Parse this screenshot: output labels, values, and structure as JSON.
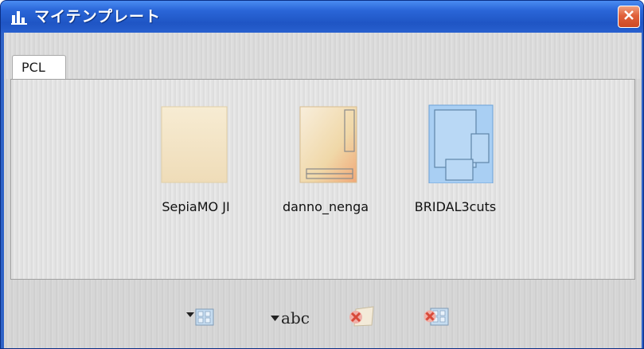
{
  "window": {
    "title": "マイテンプレート",
    "icon": "chart-bars-icon",
    "close_icon": "close-icon"
  },
  "tabs": [
    {
      "label": "PCL",
      "selected": true
    }
  ],
  "templates": [
    {
      "label": "SepiaMO JI",
      "thumbnail": "sepia-page-thumbnail"
    },
    {
      "label": "danno_nenga",
      "thumbnail": "nenga-layout-thumbnail"
    },
    {
      "label": "BRIDAL3cuts",
      "thumbnail": "bridal-layout-thumbnail",
      "selected": true
    }
  ],
  "toolbar": {
    "rename_text": "abc",
    "buttons": [
      {
        "name": "view-options-button",
        "icon": "dropdown-grid-icon"
      },
      {
        "name": "rename-button",
        "icon": "dropdown-abc-icon"
      },
      {
        "name": "delete-button",
        "icon": "delete-page-icon"
      },
      {
        "name": "delete-all-button",
        "icon": "delete-grid-icon"
      }
    ]
  },
  "colors": {
    "titlebar": "#2a66d8",
    "close": "#e0603a",
    "selection": "#9fc6ee"
  }
}
